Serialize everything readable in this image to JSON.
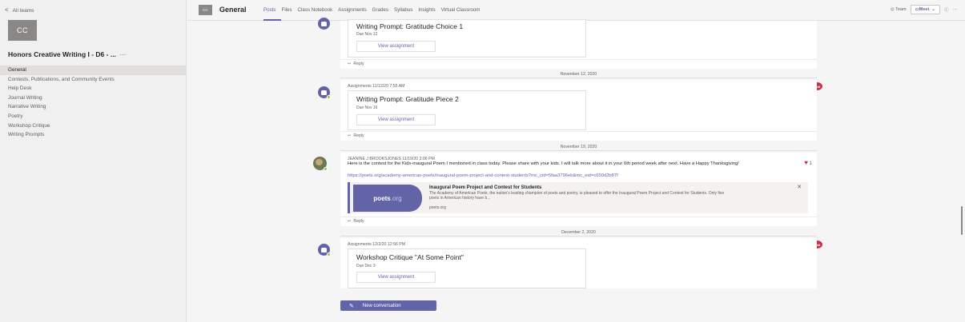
{
  "sidebar": {
    "back_label": "All teams",
    "team_initials": "CC",
    "team_name": "Honors Creative Writing I - D6 - ...",
    "more": "···",
    "channels": [
      "General",
      "Contests, Publications, and Community Events",
      "Help Desk",
      "Journal Writing",
      "Narrative Writing",
      "Poetry",
      "Workshop Critique",
      "Writing Prompts"
    ]
  },
  "header": {
    "team_initials": "CC",
    "title": "General",
    "tabs": [
      "Posts",
      "Files",
      "Class Notebook",
      "Assignments",
      "Grades",
      "Syllabus",
      "Insights",
      "Virtual Classroom"
    ],
    "team_label": "Team",
    "meet_label": "Meet",
    "more": "···"
  },
  "feed": {
    "post1": {
      "title": "Writing Prompt: Gratitude Choice 1",
      "due": "Due Nov 12",
      "button": "View assignment",
      "reply": "Reply"
    },
    "sep1": "November 12, 2020",
    "post2": {
      "meta": "Assignments  11/12/20 7:55 AM",
      "title": "Writing Prompt: Gratitude Piece 2",
      "due": "Due Nov 16",
      "button": "View assignment",
      "reply": "Reply",
      "badge": "Edit"
    },
    "sep2": "November 19, 2020",
    "post3": {
      "meta": "JEANINE J BROOKSJONES  11/19/20 3:06 PM",
      "text": "Here is the contest for the Kids-inaugural Poem I mentioned in class today. Please share with your kids. I will talk more about it in your 6th period week after next. Have a Happy Thanksgiving!",
      "link": "https://poets.org/academy-american-poets/inaugural-poem-project-and-contest-students?mc_cid=5faa3796eb&mc_eid=c650d2b87f",
      "preview_title": "Inaugural Poem Project and Contest for Students",
      "preview_desc": "The Academy of American Poets, the nation's leading champion of poets and poetry, is pleased to offer the Inaugural Poem Project and Contest for Students. Only five poets in American history have b...",
      "preview_source": "poets.org",
      "logo_main": "poets",
      "logo_suffix": ".org",
      "reaction_count": "1",
      "reply": "Reply"
    },
    "sep3": "December 2, 2020",
    "post4": {
      "meta": "Assignments  12/2/20 12:56 PM",
      "title": "Workshop Critique \"At Some Point\"",
      "due": "Due Dec 3",
      "button": "View assignment",
      "badge": "Edit"
    },
    "new_conversation": "New conversation"
  }
}
